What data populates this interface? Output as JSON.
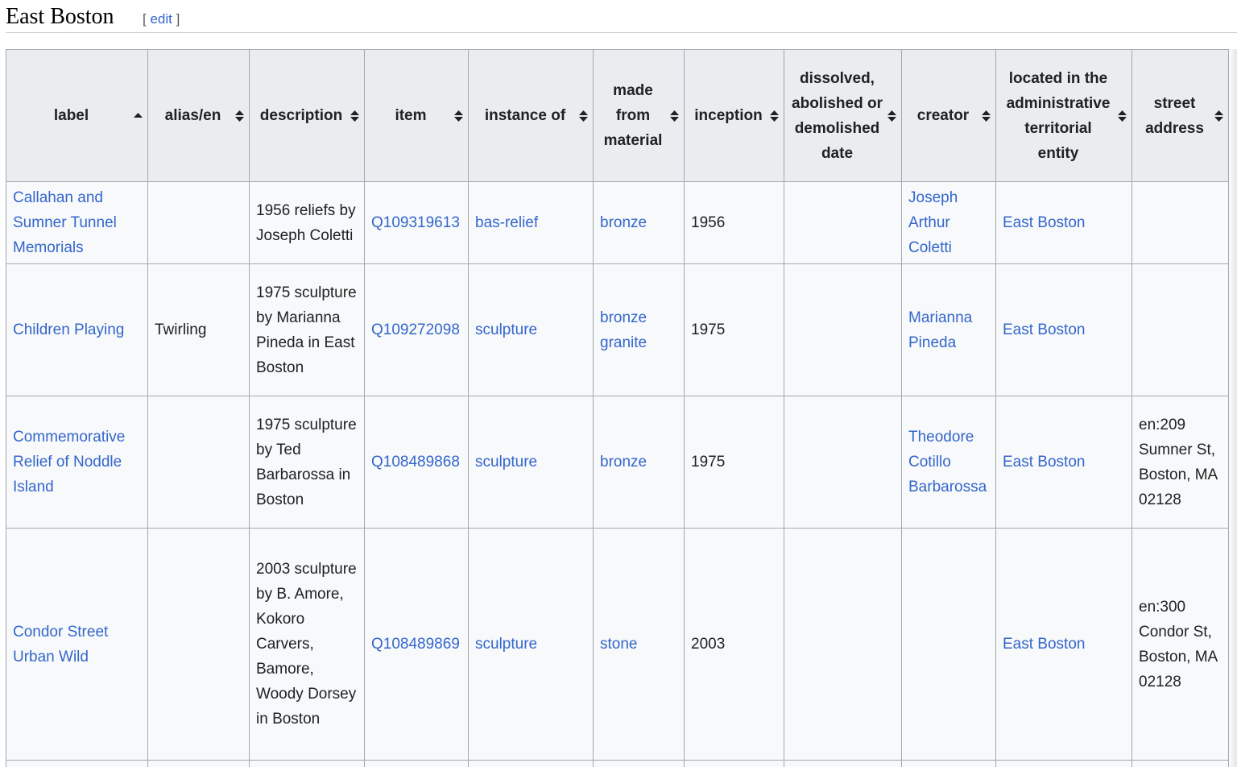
{
  "section": {
    "title": "East Boston",
    "edit_open": "[",
    "edit_label": "edit",
    "edit_close": "]"
  },
  "table": {
    "columns": [
      {
        "label": "label",
        "sort": "ascending"
      },
      {
        "label": "alias/en",
        "sort": "none"
      },
      {
        "label": "description",
        "sort": "none"
      },
      {
        "label": "item",
        "sort": "none"
      },
      {
        "label": "instance of",
        "sort": "none"
      },
      {
        "label": "made from material",
        "sort": "none"
      },
      {
        "label": "inception",
        "sort": "none"
      },
      {
        "label": "dissolved, abolished or demolished date",
        "sort": "none"
      },
      {
        "label": "creator",
        "sort": "none"
      },
      {
        "label": "located in the administrative territorial entity",
        "sort": "none"
      },
      {
        "label": "street address",
        "sort": "none"
      }
    ],
    "rows": [
      {
        "label": "Callahan and Sumner Tunnel Memorials",
        "alias": "",
        "description": "1956 reliefs by Joseph Coletti",
        "item": "Q109319613",
        "instance_of": "bas-relief",
        "materials": [
          "bronze"
        ],
        "inception": "1956",
        "dissolved": "",
        "creator": "Joseph Arthur Coletti",
        "located_in": "East Boston",
        "address": ""
      },
      {
        "label": "Children Playing",
        "alias": "Twirling",
        "description": "1975 sculpture by Marianna Pineda in East Boston",
        "item": "Q109272098",
        "instance_of": "sculpture",
        "materials": [
          "bronze",
          "granite"
        ],
        "inception": "1975",
        "dissolved": "",
        "creator": "Marianna Pineda",
        "located_in": "East Boston",
        "address": ""
      },
      {
        "label": "Commemorative Relief of Noddle Island",
        "alias": "",
        "description": "1975 sculpture by Ted Barbarossa in Boston",
        "item": "Q108489868",
        "instance_of": "sculpture",
        "materials": [
          "bronze"
        ],
        "inception": "1975",
        "dissolved": "",
        "creator": "Theodore Cotillo Barbarossa",
        "located_in": "East Boston",
        "address": "en:209 Sumner St, Boston, MA 02128"
      },
      {
        "label": "Condor Street Urban Wild",
        "alias": "",
        "description": "2003 sculpture by B. Amore, Kokoro Carvers, Bamore, Woody Dorsey in Boston",
        "item": "Q108489869",
        "instance_of": "sculpture",
        "materials": [
          "stone"
        ],
        "inception": "2003",
        "dissolved": "",
        "creator": "",
        "located_in": "East Boston",
        "address": "en:300 Condor St, Boston, MA 02128"
      }
    ]
  },
  "colors": {
    "link": "#3366cc",
    "header_bg": "#eaecf0",
    "cell_bg": "#f8f9fa",
    "border": "#a2a9b1"
  },
  "icons": {
    "sort_ascending": "sort-ascending-icon",
    "sort_both": "sort-both-icon"
  }
}
